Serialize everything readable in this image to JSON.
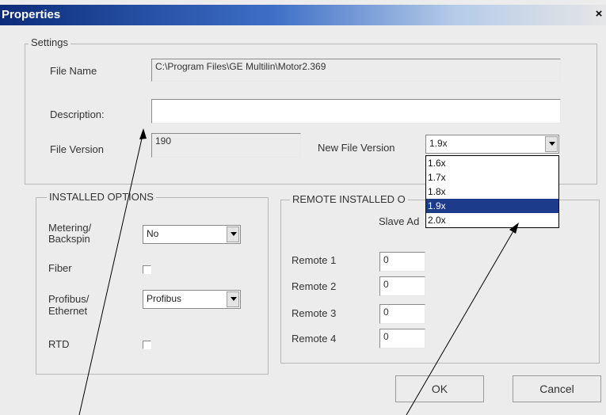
{
  "window": {
    "title": "Properties",
    "close_glyph": "×"
  },
  "settings": {
    "legend": "Settings",
    "file_name_label": "File Name",
    "file_name_value": "C:\\Program Files\\GE Multilin\\Motor2.369",
    "description_label": "Description:",
    "description_value": "",
    "file_version_label": "File Version",
    "file_version_value": "190",
    "new_file_version_label": "New File Version",
    "new_file_version_value": "1.9x",
    "version_options": [
      "1.6x",
      "1.7x",
      "1.8x",
      "1.9x",
      "2.0x"
    ],
    "selected_option_index": 3
  },
  "installed_options": {
    "legend": "INSTALLED OPTIONS",
    "metering_label_line1": "Metering/",
    "metering_label_line2": "Backspin",
    "metering_value": "No",
    "fiber_label": "Fiber",
    "fiber_checked": false,
    "profibus_label_line1": "Profibus/",
    "profibus_label_line2": "Ethernet",
    "profibus_value": "Profibus",
    "rtd_label": "RTD",
    "rtd_checked": false
  },
  "remote_installed_options": {
    "legend_visible": "REMOTE INSTALLED O",
    "slave_address_label_visible": "Slave Ad",
    "remotes": [
      {
        "label": "Remote 1",
        "value": "0"
      },
      {
        "label": "Remote 2",
        "value": "0"
      },
      {
        "label": "Remote 3",
        "value": "0"
      },
      {
        "label": "Remote 4",
        "value": "0"
      }
    ]
  },
  "buttons": {
    "ok": "OK",
    "cancel": "Cancel"
  },
  "colors": {
    "title_start": "#0b2c7a",
    "selected_item": "#1c3b8a",
    "dialog_bg": "#ececec"
  }
}
